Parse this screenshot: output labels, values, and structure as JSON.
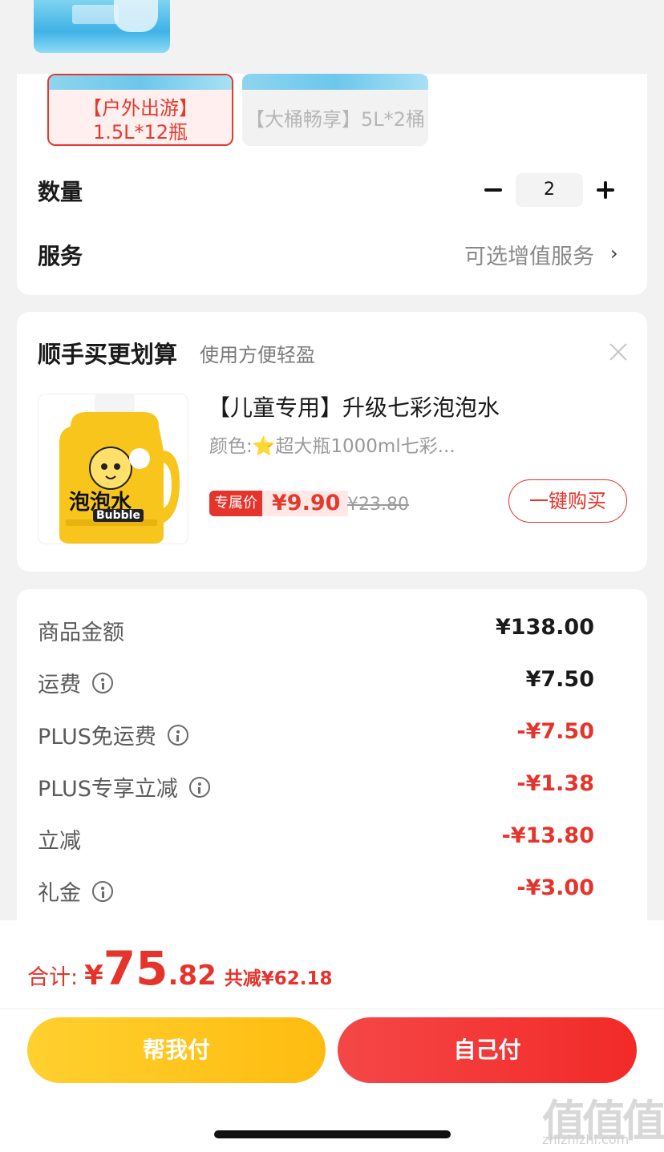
{
  "specs": [
    {
      "label": "【户外出游】1.5L*12瓶",
      "selected": true
    },
    {
      "label": "【大桶畅享】5L*2桶",
      "selected": false
    }
  ],
  "quantity": {
    "label": "数量",
    "value": "2"
  },
  "service": {
    "label": "服务",
    "value": "可选增值服务"
  },
  "addon": {
    "title": "顺手买更划算",
    "subtitle": "使用方便轻盈",
    "product_title": "【儿童专用】升级七彩泡泡水",
    "product_spec": "颜色:⭐超大瓶1000ml七彩...",
    "price_tag": "专属价",
    "price": "¥9.90",
    "original_price": "¥23.80",
    "buy_label": "一键购买",
    "product_image_text": "泡泡水",
    "product_image_subtext": "Bubble"
  },
  "fees": [
    {
      "label": "商品金额",
      "value": "¥138.00",
      "info": false,
      "highlight": false
    },
    {
      "label": "运费",
      "value": "¥7.50",
      "info": true,
      "highlight": false
    },
    {
      "label": "PLUS免运费",
      "value": "-¥7.50",
      "info": true,
      "highlight": true
    },
    {
      "label": "PLUS专享立减",
      "value": "-¥1.38",
      "info": true,
      "highlight": true
    },
    {
      "label": "立减",
      "value": "-¥13.80",
      "info": false,
      "highlight": true
    },
    {
      "label": "礼金",
      "value": "-¥3.00",
      "info": true,
      "highlight": true
    }
  ],
  "total": {
    "label": "合计:",
    "currency": "¥",
    "integer": "75",
    "decimal": ".82",
    "saved": "共减¥62.18"
  },
  "buttons": {
    "help_pay": "帮我付",
    "self_pay": "自己付"
  },
  "watermark": {
    "mark": "值值值",
    "url": "zhizhizhi.com"
  },
  "colors": {
    "accent_red": "#e5342b",
    "help_yellow": "#ffc61c"
  }
}
